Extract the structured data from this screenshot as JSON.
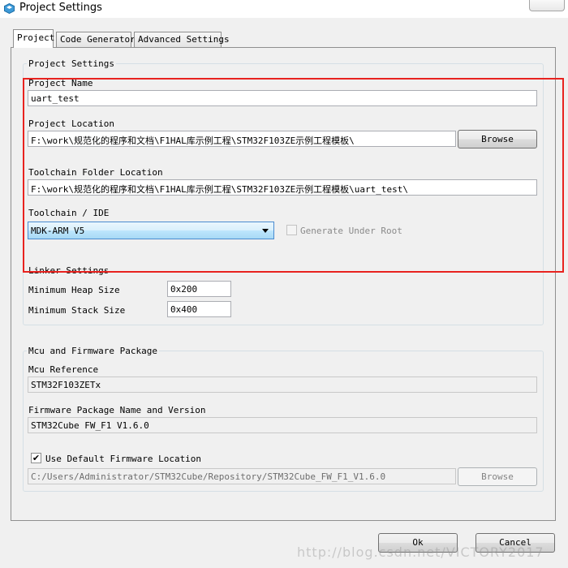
{
  "window": {
    "title": "Project Settings",
    "icon": "stm32cubemx-app-icon"
  },
  "tabs": [
    {
      "label": "Project",
      "active": true
    },
    {
      "label": "Code Generator",
      "active": false
    },
    {
      "label": "Advanced Settings",
      "active": false
    }
  ],
  "project_settings": {
    "group_title": "Project Settings",
    "project_name_label": "Project Name",
    "project_name_value": "uart_test",
    "project_location_label": "Project Location",
    "project_location_value": "F:\\work\\规范化的程序和文档\\F1HAL库示例工程\\STM32F103ZE示例工程模板\\",
    "browse_label": "Browse",
    "toolchain_folder_label": "Toolchain Folder Location",
    "toolchain_folder_value": "F:\\work\\规范化的程序和文档\\F1HAL库示例工程\\STM32F103ZE示例工程模板\\uart_test\\",
    "toolchain_ide_label": "Toolchain / IDE",
    "toolchain_ide_selected": "MDK-ARM V5",
    "generate_under_root_label": "Generate Under Root",
    "generate_under_root_checked": false
  },
  "linker_settings": {
    "group_title": "Linker Settings",
    "min_heap_label": "Minimum Heap Size",
    "min_heap_value": "0x200",
    "min_stack_label": "Minimum Stack Size",
    "min_stack_value": "0x400"
  },
  "mcu_firmware": {
    "group_title": "Mcu and Firmware Package",
    "mcu_reference_label": "Mcu Reference",
    "mcu_reference_value": "STM32F103ZETx",
    "firmware_package_label": "Firmware Package Name and Version",
    "firmware_package_value": "STM32Cube FW_F1 V1.6.0",
    "use_default_location_label": "Use Default Firmware Location",
    "use_default_location_checked": true,
    "firmware_location_value": "C:/Users/Administrator/STM32Cube/Repository/STM32Cube_FW_F1_V1.6.0",
    "browse_label": "Browse"
  },
  "footer": {
    "ok_label": "Ok",
    "cancel_label": "Cancel"
  },
  "watermark": "http://blog.csdn.net/VICTORY2017",
  "colors": {
    "highlight_box": "#e8231f",
    "select_accent": "#4a8bd0"
  }
}
